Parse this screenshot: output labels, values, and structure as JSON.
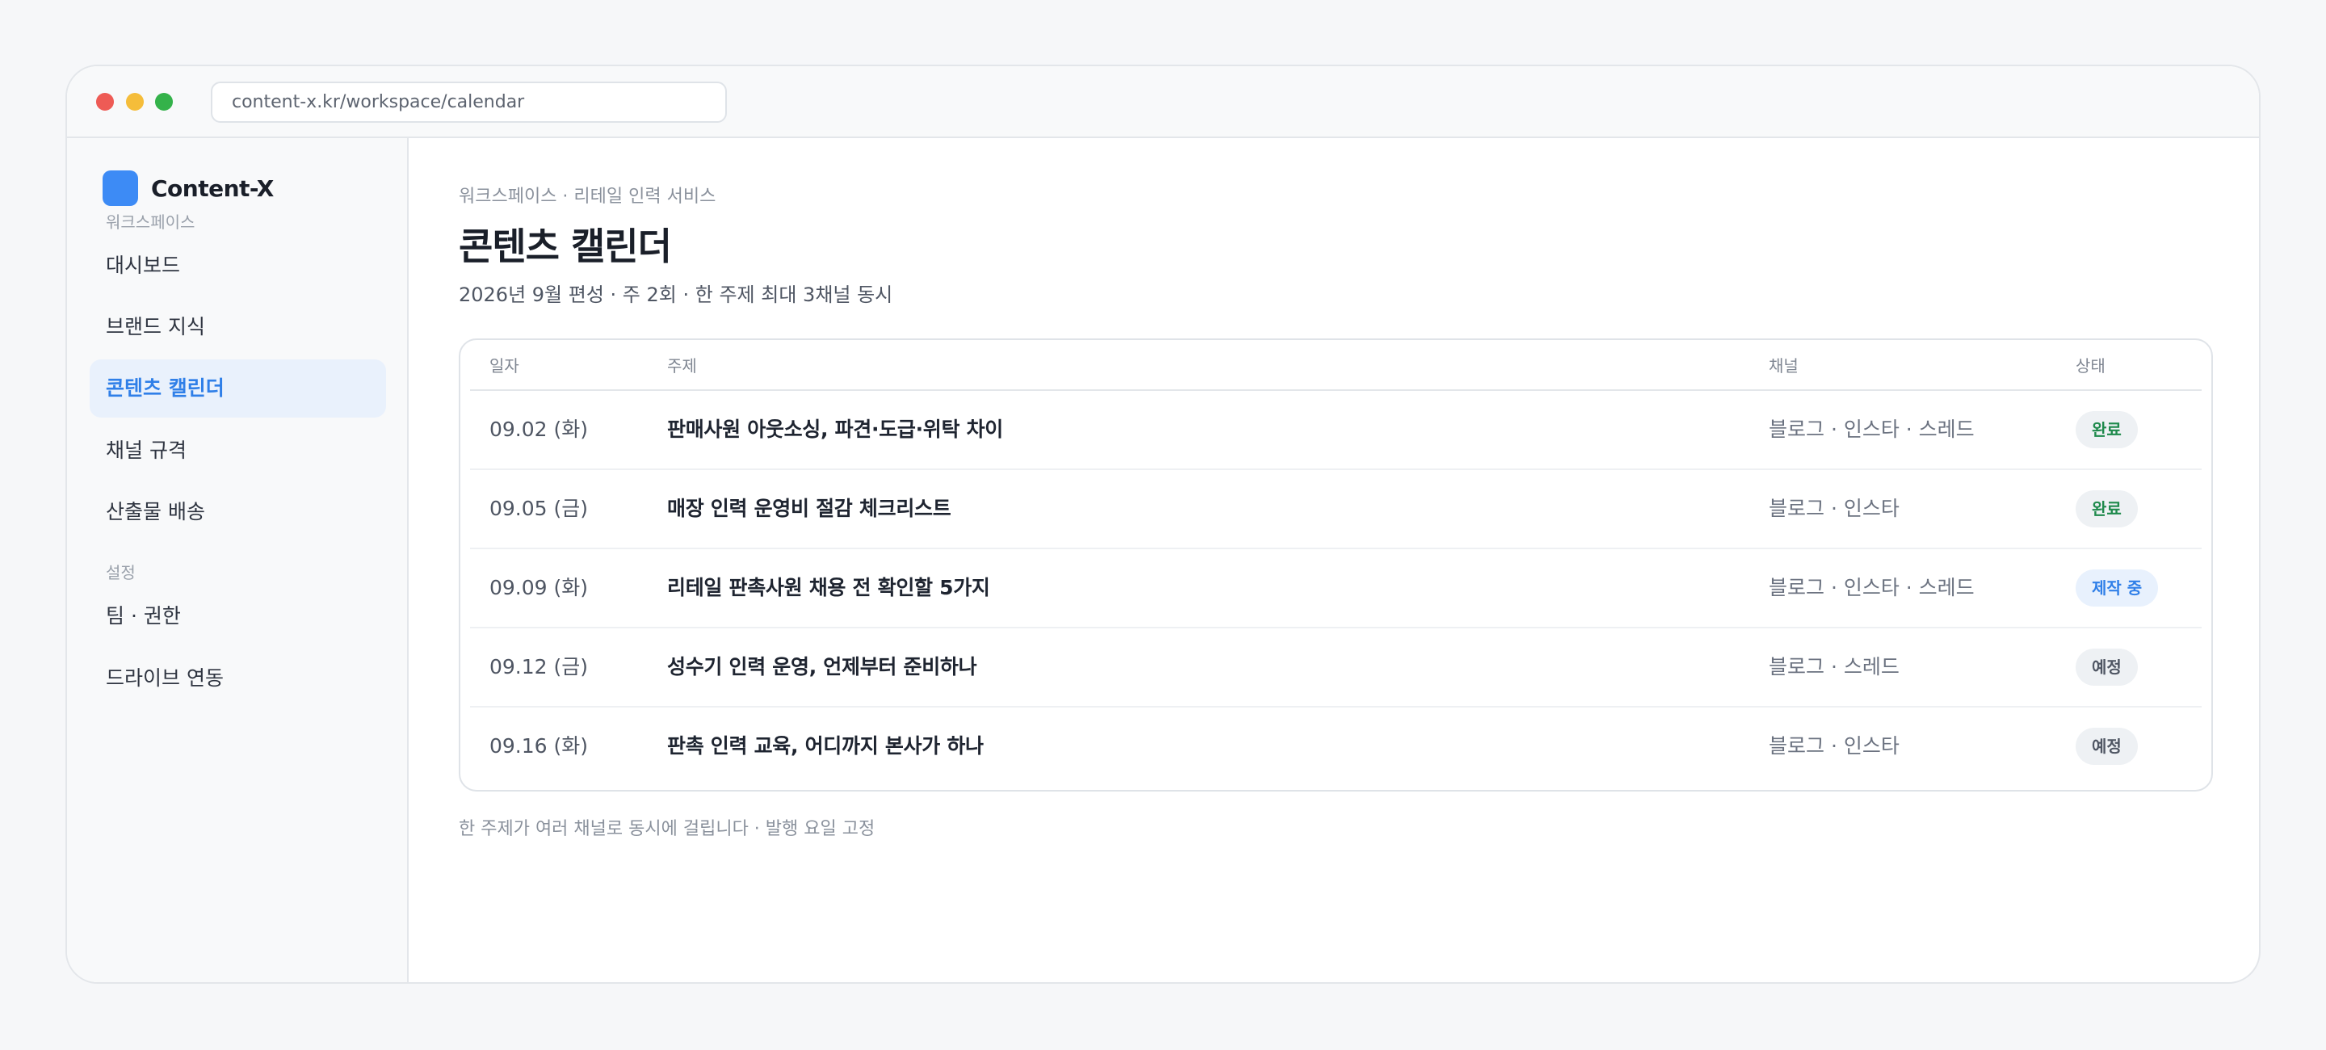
{
  "browser": {
    "url": "content-x.kr/workspace/calendar"
  },
  "sidebar": {
    "brand_name": "Content-X",
    "section_workspace": "워크스페이스",
    "items_workspace": [
      {
        "label": "대시보드"
      },
      {
        "label": "브랜드 지식"
      },
      {
        "label": "콘텐츠 캘린더",
        "active": true
      },
      {
        "label": "채널 규격"
      },
      {
        "label": "산출물 배송"
      }
    ],
    "section_settings": "설정",
    "items_settings": [
      {
        "label": "팀 · 권한"
      },
      {
        "label": "드라이브 연동"
      }
    ]
  },
  "main": {
    "breadcrumb": "워크스페이스 · 리테일 인력 서비스",
    "title": "콘텐츠 캘린더",
    "subtitle": "2026년 9월 편성 · 주 2회 · 한 주제 최대 3채널 동시",
    "table": {
      "headers": {
        "date": "일자",
        "topic": "주제",
        "channel": "채널",
        "status": "상태"
      },
      "rows": [
        {
          "date": "09.02 (화)",
          "topic": "판매사원 아웃소싱, 파견·도급·위탁 차이",
          "channel": "블로그 · 인스타 · 스레드",
          "status": "완료"
        },
        {
          "date": "09.05 (금)",
          "topic": "매장 인력 운영비 절감 체크리스트",
          "channel": "블로그 · 인스타",
          "status": "완료"
        },
        {
          "date": "09.09 (화)",
          "topic": "리테일 판촉사원 채용 전 확인할 5가지",
          "channel": "블로그 · 인스타 · 스레드",
          "status": "제작 중"
        },
        {
          "date": "09.12 (금)",
          "topic": "성수기 인력 운영, 언제부터 준비하나",
          "channel": "블로그 · 스레드",
          "status": "예정"
        },
        {
          "date": "09.16 (화)",
          "topic": "판촉 인력 교육, 어디까지 본사가 하나",
          "channel": "블로그 · 인스타",
          "status": "예정"
        }
      ]
    },
    "footnote": "한 주제가 여러 채널로 동시에 걸립니다 · 발행 요일 고정"
  },
  "colors": {
    "accent": "#2f7fe8",
    "status_done": "#1f8a4c",
    "status_progress": "#2f7fe8",
    "status_planned": "#4f5663"
  }
}
